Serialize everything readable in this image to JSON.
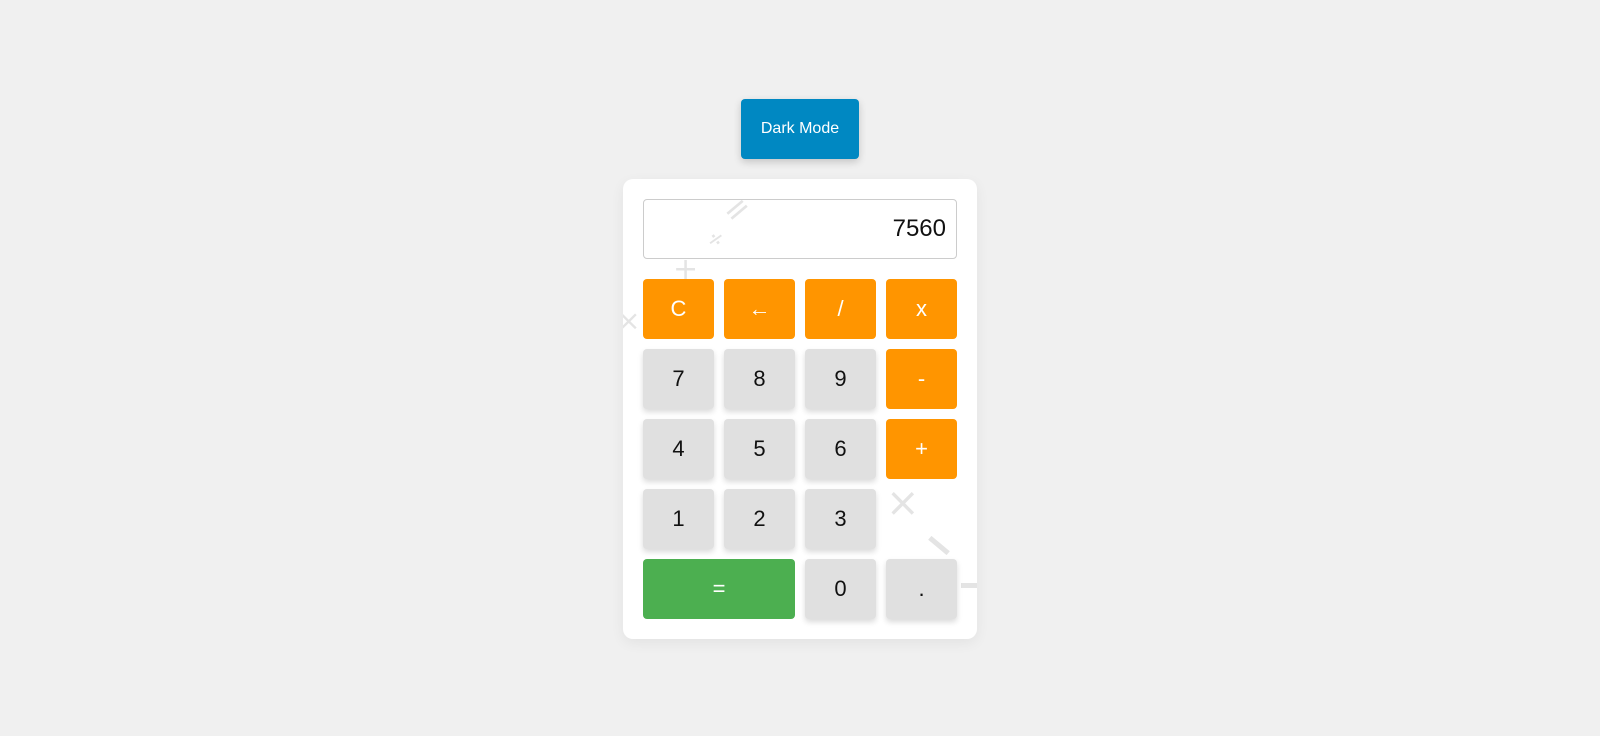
{
  "mode_toggle": {
    "label": "Dark Mode",
    "color": "#0088c2"
  },
  "display": {
    "value": "7560"
  },
  "keys": {
    "clear": "C",
    "backspace": "←",
    "divide": "/",
    "multiply": "x",
    "seven": "7",
    "eight": "8",
    "nine": "9",
    "subtract": "-",
    "four": "4",
    "five": "5",
    "six": "6",
    "add": "+",
    "one": "1",
    "two": "2",
    "three": "3",
    "equals": "=",
    "zero": "0",
    "decimal": "."
  },
  "colors": {
    "operator": "#ff9500",
    "equals": "#4caf50",
    "number": "#e0e0e0"
  },
  "decorations": [
    "×",
    "÷",
    "+",
    "="
  ]
}
